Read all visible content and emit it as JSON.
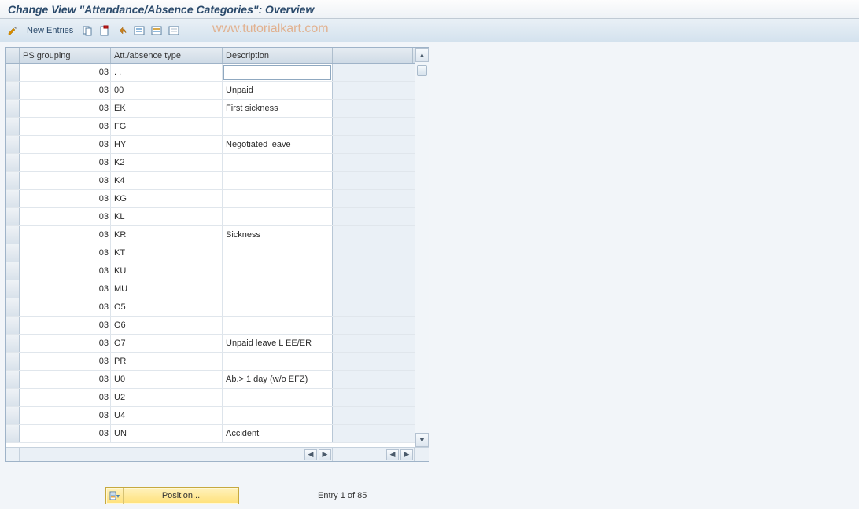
{
  "title": "Change View \"Attendance/Absence Categories\": Overview",
  "toolbar": {
    "new_entries_label": "New Entries"
  },
  "watermark": "www.tutorialkart.com",
  "columns": {
    "ps_grouping": "PS grouping",
    "att_type": "Att./absence type",
    "description": "Description"
  },
  "rows": [
    {
      "ps": "03",
      "type": " . .",
      "desc": ""
    },
    {
      "ps": "03",
      "type": "00",
      "desc": "Unpaid"
    },
    {
      "ps": "03",
      "type": "EK",
      "desc": "First sickness"
    },
    {
      "ps": "03",
      "type": "FG",
      "desc": ""
    },
    {
      "ps": "03",
      "type": "HY",
      "desc": "Negotiated leave"
    },
    {
      "ps": "03",
      "type": "K2",
      "desc": ""
    },
    {
      "ps": "03",
      "type": "K4",
      "desc": ""
    },
    {
      "ps": "03",
      "type": "KG",
      "desc": ""
    },
    {
      "ps": "03",
      "type": "KL",
      "desc": ""
    },
    {
      "ps": "03",
      "type": "KR",
      "desc": "Sickness"
    },
    {
      "ps": "03",
      "type": "KT",
      "desc": ""
    },
    {
      "ps": "03",
      "type": "KU",
      "desc": ""
    },
    {
      "ps": "03",
      "type": "MU",
      "desc": ""
    },
    {
      "ps": "03",
      "type": "O5",
      "desc": ""
    },
    {
      "ps": "03",
      "type": "O6",
      "desc": ""
    },
    {
      "ps": "03",
      "type": "O7",
      "desc": "Unpaid leave L EE/ER"
    },
    {
      "ps": "03",
      "type": "PR",
      "desc": ""
    },
    {
      "ps": "03",
      "type": "U0",
      "desc": "Ab.> 1 day (w/o EFZ)"
    },
    {
      "ps": "03",
      "type": "U2",
      "desc": ""
    },
    {
      "ps": "03",
      "type": "U4",
      "desc": ""
    },
    {
      "ps": "03",
      "type": "UN",
      "desc": "Accident"
    }
  ],
  "footer": {
    "position_label": "Position...",
    "entry_text": "Entry 1 of 85"
  }
}
